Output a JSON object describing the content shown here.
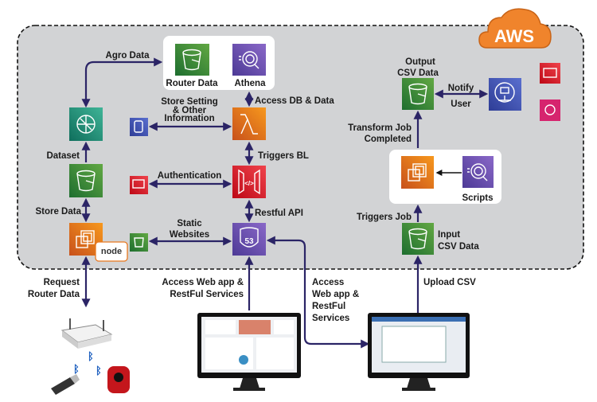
{
  "brand": {
    "logo_text": "AWS",
    "colors": {
      "cloud": "#f0842c",
      "arrow": "#2b2466",
      "s3": "#3f8f3a",
      "compute": "#e8781f",
      "purple": "#6b4fa8",
      "red": "#d9272e",
      "teal": "#1a8a73",
      "blue": "#4055a8",
      "pink": "#d6246e"
    }
  },
  "nodes": {
    "router_data": "Router Data",
    "athena": "Athena",
    "output_csv": [
      "Output",
      "CSV Data"
    ],
    "scripts": "Scripts",
    "input_csv": [
      "Input",
      "CSV Data"
    ],
    "node_badge": "node"
  },
  "labels": {
    "agro_data": "Agro Data",
    "access_db": "Access DB & Data",
    "store_setting": [
      "Store Setting",
      "& Other",
      "Information"
    ],
    "triggers_bl": "Triggers BL",
    "authentication": "Authentication",
    "restful_api": "Restful API",
    "static_websites": [
      "Static",
      "Websites"
    ],
    "dataset": "Dataset",
    "store_data": "Store  Data",
    "notify_user": [
      "Notify",
      "User"
    ],
    "transform_job": [
      "Transform Job",
      "Completed"
    ],
    "triggers_job": "Triggers Job",
    "request_router": [
      "Request",
      "Router Data"
    ],
    "access_web_1": [
      "Access Web app &",
      "RestFul Services"
    ],
    "access_web_2": [
      "Access",
      "Web app &",
      "RestFul",
      "Services"
    ],
    "upload_csv": "Upload CSV"
  },
  "icons": [
    "s3-bucket-icon",
    "athena-icon",
    "lambda-icon",
    "api-gateway-icon",
    "route53-icon",
    "sagemaker-icon",
    "ec2-icon",
    "dynamodb-icon",
    "cognito-icon",
    "sns-icon",
    "iam-icon",
    "cloudwatch-icon",
    "router-icon",
    "bluetooth-icon",
    "usb-dongle-icon",
    "sensor-icon",
    "monitor-icon"
  ]
}
